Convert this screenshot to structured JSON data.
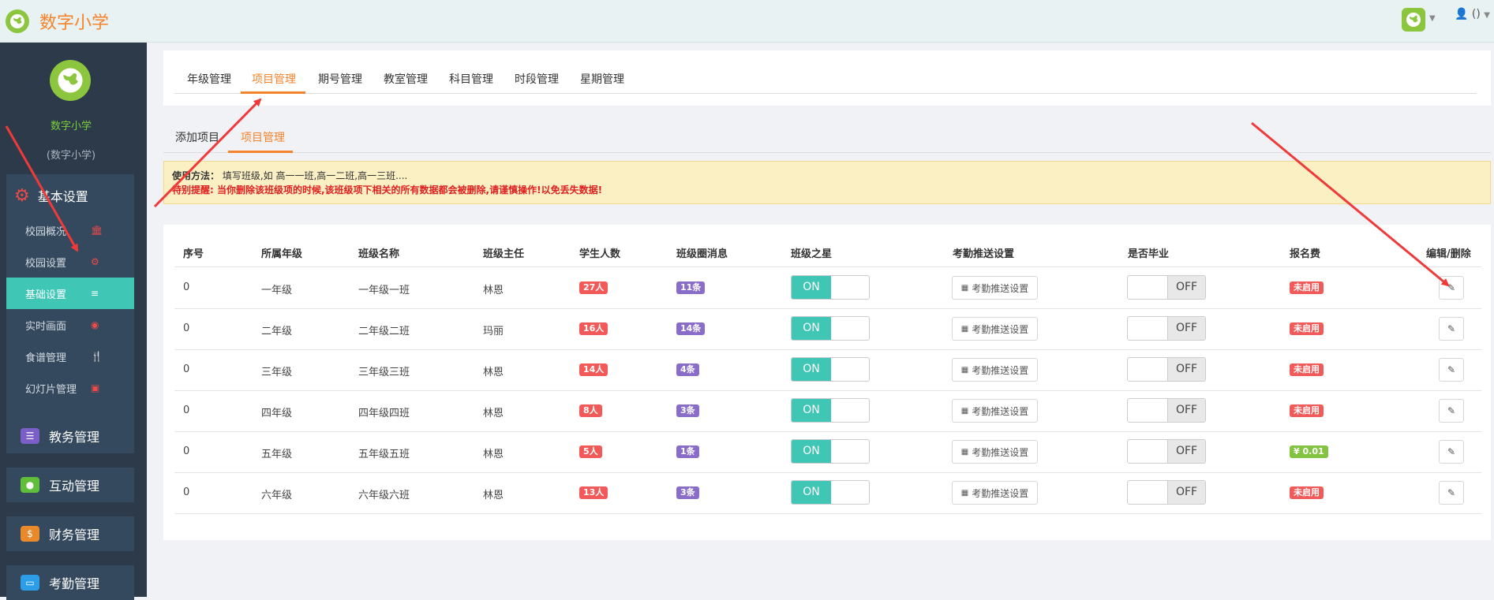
{
  "app": {
    "title": "数字小学"
  },
  "topbar": {
    "user_label": "()"
  },
  "sidebar": {
    "school_name": "数字小学",
    "school_sub": "(数字小学)",
    "group_title": "基本设置",
    "items": [
      {
        "label": "校园概况",
        "icon": "bank-icon"
      },
      {
        "label": "校园设置",
        "icon": "gear-icon"
      },
      {
        "label": "基础设置",
        "icon": "list-icon"
      },
      {
        "label": "实时画面",
        "icon": "eye-icon"
      },
      {
        "label": "食谱管理",
        "icon": "cutlery-icon"
      },
      {
        "label": "幻灯片管理",
        "icon": "picture-icon"
      }
    ],
    "modules": [
      {
        "label": "教务管理",
        "icon": "database-icon",
        "color": "#7b5fc7"
      },
      {
        "label": "互动管理",
        "icon": "wechat-icon",
        "color": "#5fbf3b"
      },
      {
        "label": "财务管理",
        "icon": "money-icon",
        "color": "#e88a2c"
      },
      {
        "label": "考勤管理",
        "icon": "card-icon",
        "color": "#2c9ee8"
      }
    ]
  },
  "top_tabs": [
    "年级管理",
    "项目管理",
    "期号管理",
    "教室管理",
    "科目管理",
    "时段管理",
    "星期管理"
  ],
  "sub_tabs": [
    "添加项目",
    "项目管理"
  ],
  "notice": {
    "usage_label": "使用方法：",
    "usage_text": "填写班级,如 高一一班,高一二班,高一三班....",
    "warning": "特别提醒: 当你删除该班级项的时候,该班级项下相关的所有数据都会被删除,请谨慎操作!以免丢失数据!"
  },
  "table": {
    "headers": [
      "序号",
      "所属年级",
      "班级名称",
      "班级主任",
      "学生人数",
      "班级圈消息",
      "班级之星",
      "考勤推送设置",
      "是否毕业",
      "报名费",
      "编辑/删除"
    ],
    "rows": [
      {
        "no": "0",
        "grade": "一年级",
        "class": "一年级一班",
        "teacher": "林恩",
        "students": "27人",
        "msgs": "11条",
        "star": "ON",
        "attend": "考勤推送设置",
        "grad": "OFF",
        "fee": "未启用",
        "fee_color": "#f25959"
      },
      {
        "no": "0",
        "grade": "二年级",
        "class": "二年级二班",
        "teacher": "玛丽",
        "students": "16人",
        "msgs": "14条",
        "star": "ON",
        "attend": "考勤推送设置",
        "grad": "OFF",
        "fee": "未启用",
        "fee_color": "#f25959"
      },
      {
        "no": "0",
        "grade": "三年级",
        "class": "三年级三班",
        "teacher": "林恩",
        "students": "14人",
        "msgs": "4条",
        "star": "ON",
        "attend": "考勤推送设置",
        "grad": "OFF",
        "fee": "未启用",
        "fee_color": "#f25959"
      },
      {
        "no": "0",
        "grade": "四年级",
        "class": "四年级四班",
        "teacher": "林恩",
        "students": "8人",
        "msgs": "3条",
        "star": "ON",
        "attend": "考勤推送设置",
        "grad": "OFF",
        "fee": "未启用",
        "fee_color": "#f25959"
      },
      {
        "no": "0",
        "grade": "五年级",
        "class": "五年级五班",
        "teacher": "林恩",
        "students": "5人",
        "msgs": "1条",
        "star": "ON",
        "attend": "考勤推送设置",
        "grad": "OFF",
        "fee": "¥ 0.01",
        "fee_color": "#82c341"
      },
      {
        "no": "0",
        "grade": "六年级",
        "class": "六年级六班",
        "teacher": "林恩",
        "students": "13人",
        "msgs": "3条",
        "star": "ON",
        "attend": "考勤推送设置",
        "grad": "OFF",
        "fee": "未启用",
        "fee_color": "#f25959"
      }
    ]
  },
  "colors": {
    "accent": "#f5832b",
    "teal": "#3fc6b5",
    "sidebar": "#2c3a4a",
    "arrow": "#f03a3a"
  }
}
